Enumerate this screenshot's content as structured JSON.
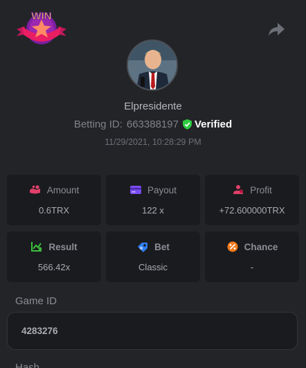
{
  "header": {
    "badge_text": "WIN"
  },
  "profile": {
    "username": "Elpresidente",
    "betting_id_label": "Betting ID:",
    "betting_id": "663388197",
    "verified_label": "Verified",
    "timestamp": "11/29/2021, 10:28:29 PM"
  },
  "stats": [
    {
      "label": "Amount",
      "value": "0.6TRX",
      "icon": "amount-icon",
      "color": "#e0406a"
    },
    {
      "label": "Payout",
      "value": "122 x",
      "icon": "payout-icon",
      "color": "#7a4df0"
    },
    {
      "label": "Profit",
      "value": "+72.600000TRX",
      "icon": "profit-icon",
      "color": "#e0406a"
    },
    {
      "label": "Result",
      "value": "566.42x",
      "icon": "result-icon",
      "color": "#3bbf3b"
    },
    {
      "label": "Bet",
      "value": "Classic",
      "icon": "bet-icon",
      "color": "#2f7df2"
    },
    {
      "label": "Chance",
      "value": "-",
      "icon": "chance-icon",
      "color": "#f07a1a"
    }
  ],
  "game": {
    "label": "Game ID",
    "value": "4283276"
  },
  "hash": {
    "label": "Hash"
  }
}
